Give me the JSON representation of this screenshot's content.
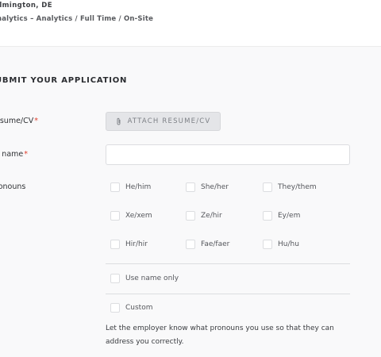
{
  "job": {
    "location": "ilmington, DE",
    "meta": "nalytics – Analytics /  Full Time /  On-Site"
  },
  "form": {
    "title": "UBMIT YOUR APPLICATION",
    "resume_label": "esume/CV",
    "required_mark": "*",
    "attach_button": "ATTACH RESUME/CV",
    "fullname_label": "ll name",
    "fullname_value": "",
    "pronouns_label": "ronouns",
    "pronoun_options": [
      "He/him",
      "She/her",
      "They/them",
      "Xe/xem",
      "Ze/hir",
      "Ey/em",
      "Hir/hir",
      "Fae/faer",
      "Hu/hu"
    ],
    "use_name_only": "Use name only",
    "custom": "Custom",
    "pronouns_help": "Let the employer know what pronouns you use so that they can address you correctly."
  },
  "icons": {
    "attach": "paperclip-icon"
  },
  "colors": {
    "required": "#e0402f",
    "button_bg": "#e4e5e8",
    "page_bg": "#f9f9fa"
  }
}
